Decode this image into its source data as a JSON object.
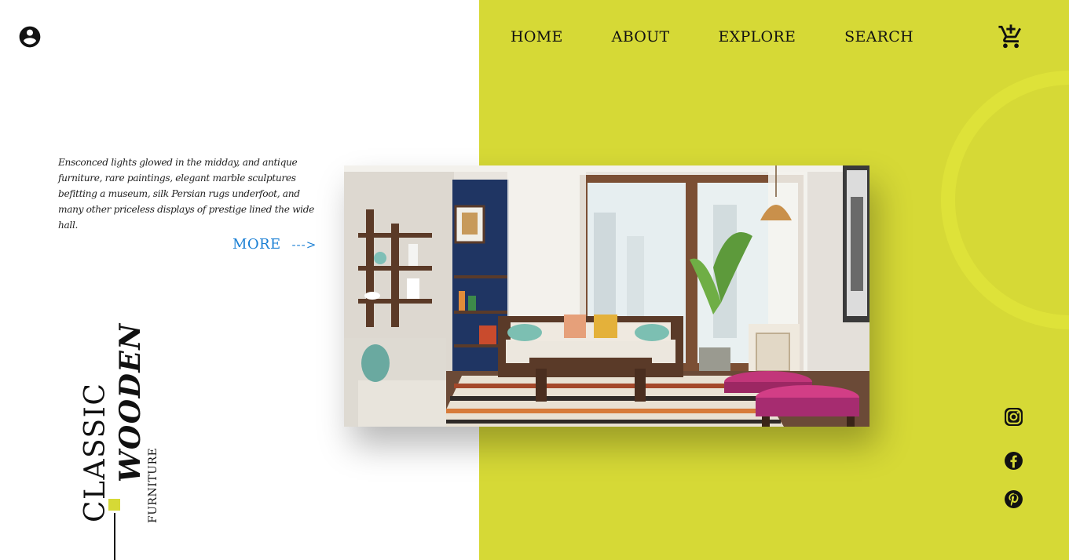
{
  "nav": {
    "items": [
      {
        "label": "HOME"
      },
      {
        "label": "ABOUT"
      },
      {
        "label": "EXPLORE"
      },
      {
        "label": "SEARCH"
      }
    ]
  },
  "icons": {
    "user": "account-circle-icon",
    "cart": "add-shopping-cart-icon",
    "social": [
      "instagram-icon",
      "facebook-icon",
      "pinterest-icon"
    ]
  },
  "intro": {
    "text": "Ensconced lights glowed in the midday, and antique furniture, rare paintings, elegant marble sculptures befitting a museum, silk Persian rugs underfoot, and many other priceless displays of prestige lined the wide hall.",
    "more_label": "MORE",
    "more_arrow": "--->"
  },
  "headline": {
    "classic": "CLASSIC",
    "wooden": "WOODEN",
    "furniture": "FURNITURE"
  },
  "colors": {
    "accent": "#d6d936",
    "link": "#1a7fd4",
    "text": "#111111"
  }
}
